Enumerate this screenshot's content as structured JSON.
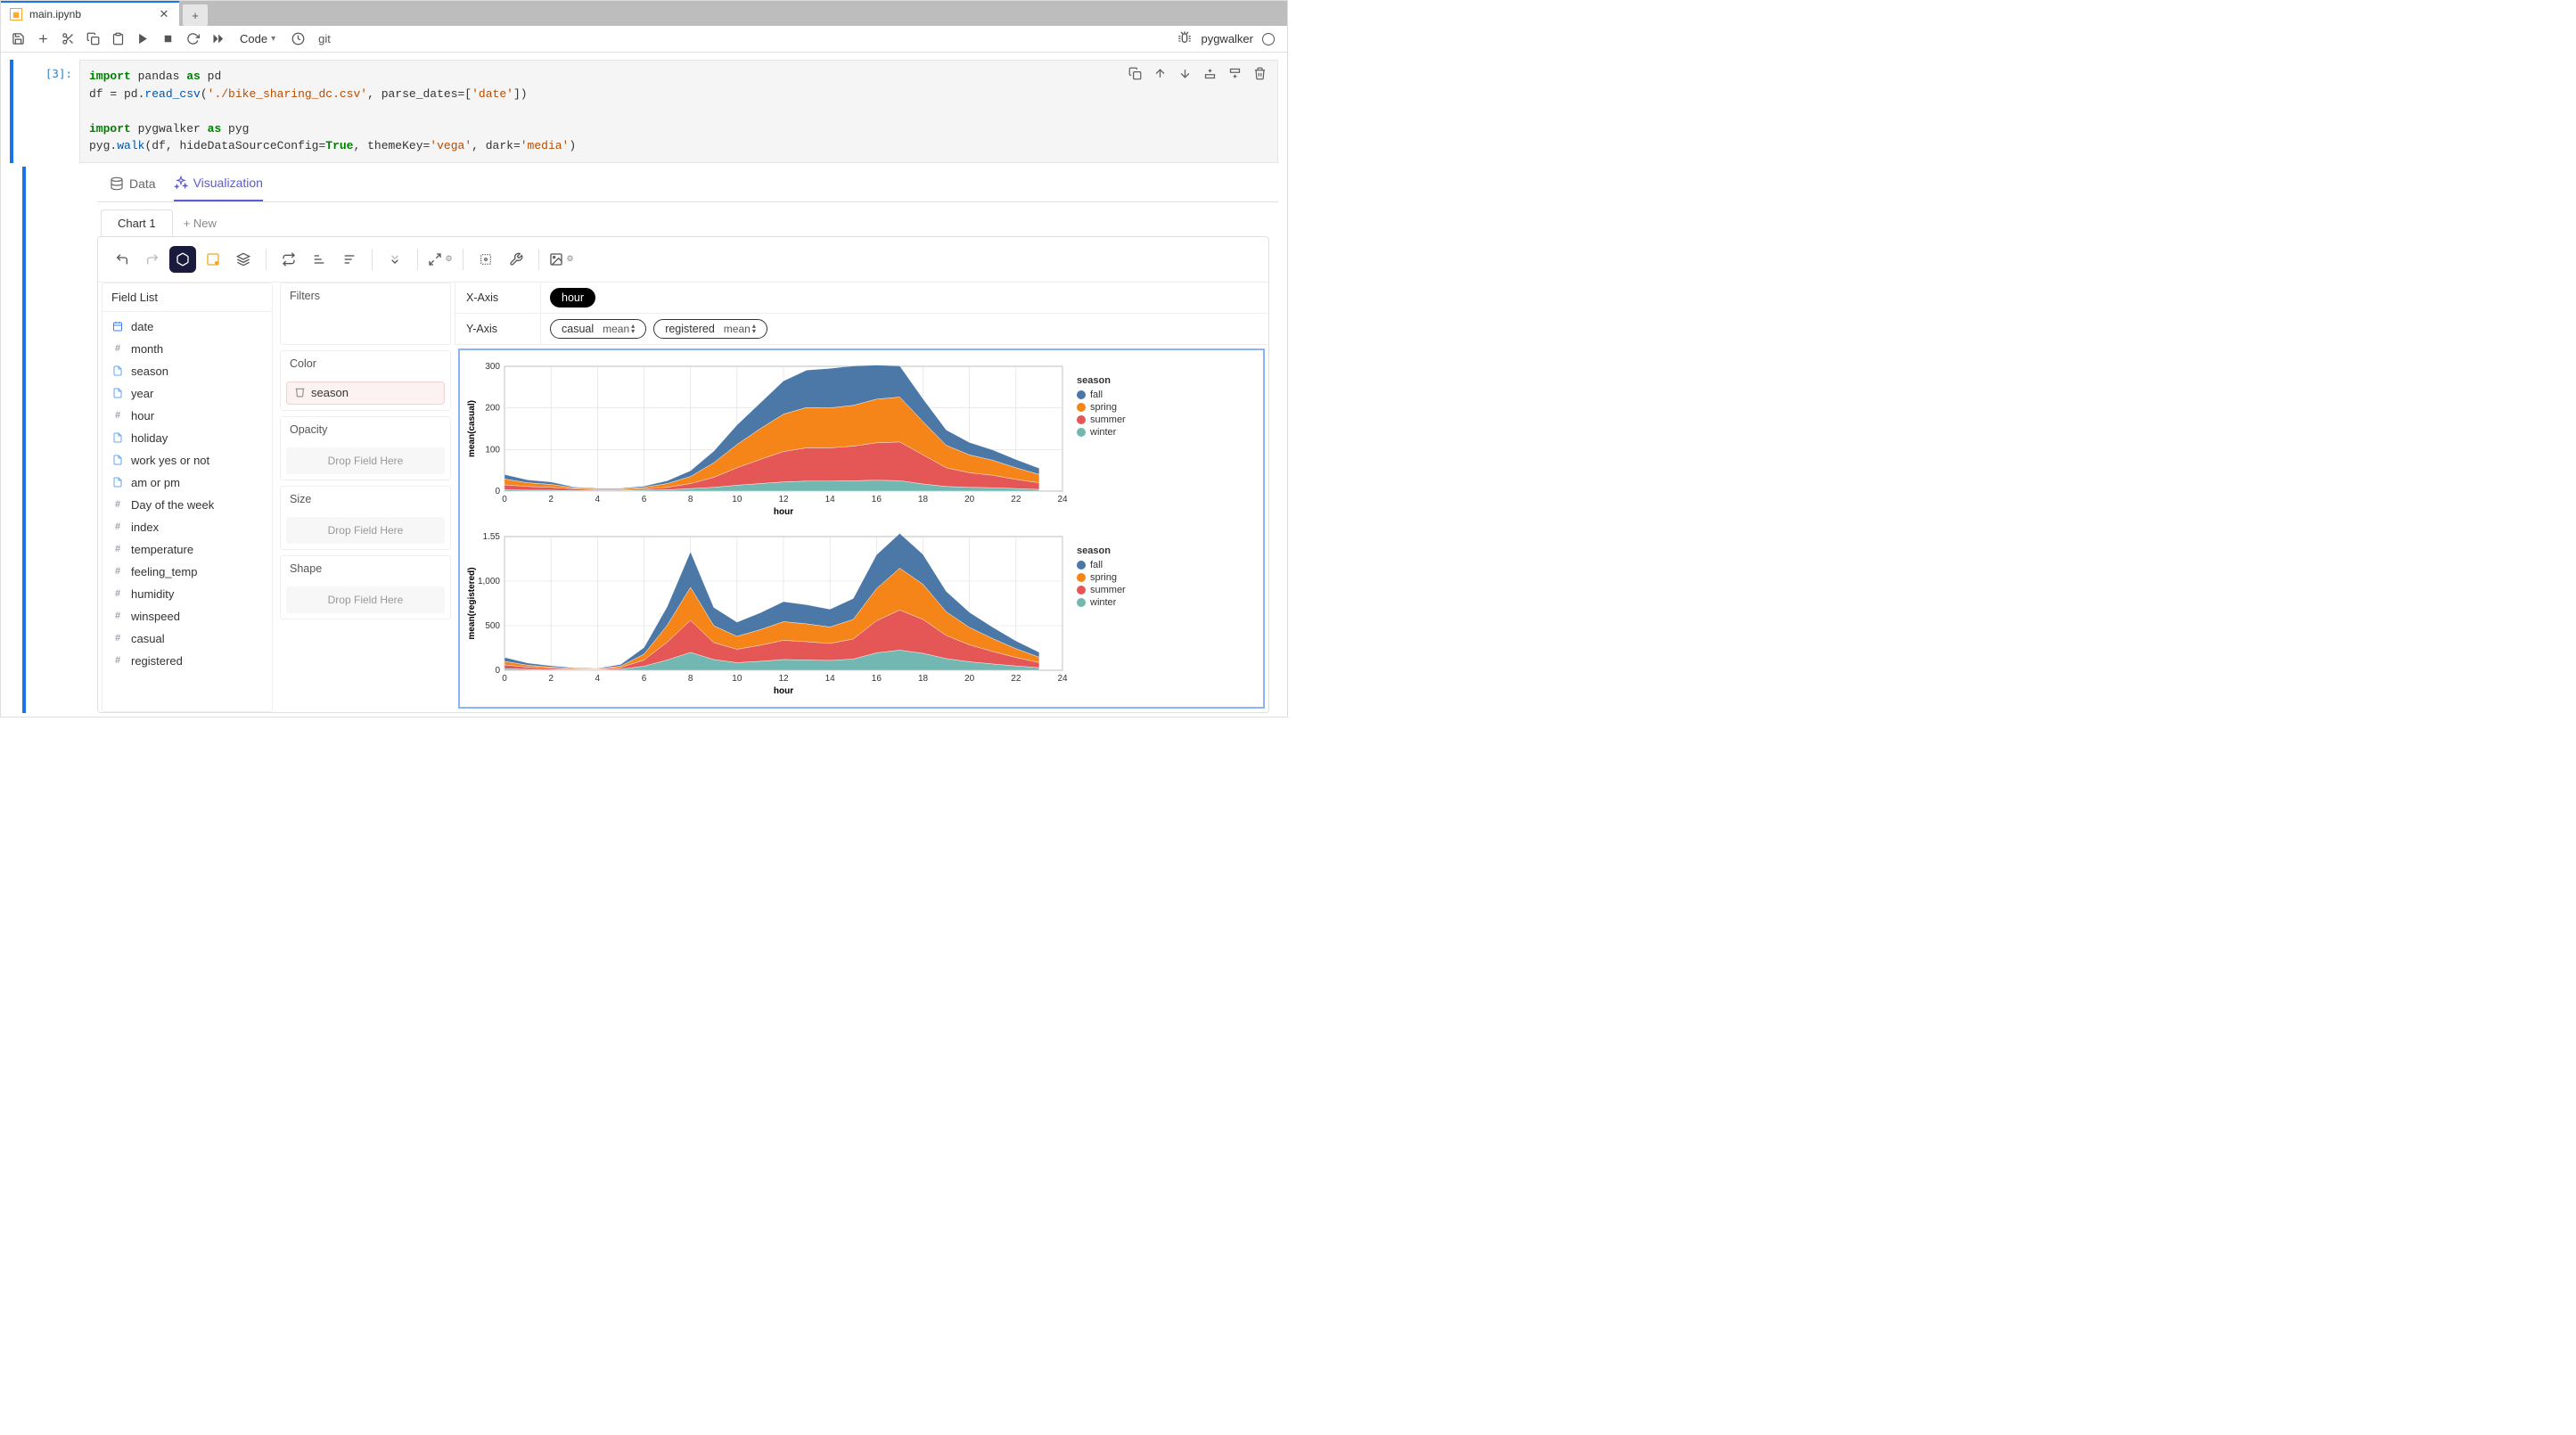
{
  "tab": {
    "title": "main.ipynb"
  },
  "toolbar": {
    "celltype": "Code",
    "git": "git",
    "kernel_name": "pygwalker"
  },
  "cell": {
    "prompt": "[3]:",
    "code_html": "<span class='kw'>import</span> pandas <span class='kw'>as</span> pd\ndf = pd.<span class='fn'>read_csv</span>(<span class='str'>'./bike_sharing_dc.csv'</span>, parse_dates=[<span class='str'>'date'</span>])\n\n<span class='kw'>import</span> pygwalker <span class='kw'>as</span> pyg\npyg.<span class='fn'>walk</span>(df, hideDataSourceConfig=<span class='cnst'>True</span>, themeKey=<span class='str'>'vega'</span>, dark=<span class='str'>'media'</span>)"
  },
  "pyg": {
    "tab_data": "Data",
    "tab_viz": "Visualization",
    "chart_tab": "Chart 1",
    "chart_tab_new": "+ New",
    "field_list_title": "Field List",
    "fields": [
      {
        "type": "cal",
        "name": "date"
      },
      {
        "type": "hash",
        "name": "month"
      },
      {
        "type": "txt",
        "name": "season"
      },
      {
        "type": "txt",
        "name": "year"
      },
      {
        "type": "hash",
        "name": "hour"
      },
      {
        "type": "txt",
        "name": "holiday"
      },
      {
        "type": "txt",
        "name": "work yes or not"
      },
      {
        "type": "txt",
        "name": "am or pm"
      },
      {
        "type": "hash",
        "name": "Day of the week"
      },
      {
        "type": "hash",
        "name": "index"
      },
      {
        "type": "hash",
        "name": "temperature"
      },
      {
        "type": "hash",
        "name": "feeling_temp"
      },
      {
        "type": "hash",
        "name": "humidity"
      },
      {
        "type": "hash",
        "name": "winspeed"
      },
      {
        "type": "hash",
        "name": "casual"
      },
      {
        "type": "hash",
        "name": "registered"
      }
    ],
    "shelves": {
      "filters": "Filters",
      "color": "Color",
      "color_value": "season",
      "opacity": "Opacity",
      "size": "Size",
      "shape": "Shape",
      "drop": "Drop Field Here"
    },
    "axes": {
      "x_label": "X-Axis",
      "y_label": "Y-Axis",
      "x_pill": "hour",
      "y_pill1": "casual",
      "y_pill1_agg": "mean",
      "y_pill2": "registered",
      "y_pill2_agg": "mean"
    },
    "legend": {
      "title": "season",
      "items": [
        {
          "name": "fall",
          "color": "#4c78a8"
        },
        {
          "name": "spring",
          "color": "#f58518"
        },
        {
          "name": "summer",
          "color": "#e45756"
        },
        {
          "name": "winter",
          "color": "#72b7b2"
        }
      ]
    }
  },
  "chart_data": [
    {
      "type": "area",
      "title": "",
      "xlabel": "hour",
      "ylabel": "mean(casual)",
      "x": [
        0,
        1,
        2,
        3,
        4,
        5,
        6,
        7,
        8,
        9,
        10,
        11,
        12,
        13,
        14,
        15,
        16,
        17,
        18,
        19,
        20,
        21,
        22,
        23
      ],
      "ylim": [
        0,
        300
      ],
      "grid": true,
      "stacked": true,
      "series": [
        {
          "name": "winter",
          "color": "#72b7b2",
          "values": [
            3,
            2,
            2,
            1,
            1,
            1,
            2,
            3,
            6,
            9,
            14,
            18,
            22,
            24,
            24,
            25,
            26,
            25,
            17,
            11,
            9,
            8,
            6,
            4
          ]
        },
        {
          "name": "summer",
          "color": "#e45756",
          "values": [
            12,
            9,
            7,
            4,
            2,
            2,
            3,
            6,
            12,
            24,
            42,
            58,
            73,
            80,
            80,
            83,
            90,
            93,
            70,
            45,
            35,
            30,
            22,
            16
          ]
        },
        {
          "name": "spring",
          "color": "#f58518",
          "values": [
            14,
            9,
            7,
            3,
            2,
            2,
            4,
            9,
            17,
            35,
            56,
            74,
            90,
            97,
            96,
            98,
            105,
            108,
            80,
            54,
            43,
            36,
            28,
            20
          ]
        },
        {
          "name": "fall",
          "color": "#4c78a8",
          "values": [
            11,
            7,
            6,
            2,
            2,
            2,
            3,
            7,
            14,
            28,
            47,
            62,
            80,
            90,
            95,
            95,
            82,
            75,
            55,
            37,
            30,
            25,
            20,
            15
          ]
        }
      ]
    },
    {
      "type": "area",
      "title": "",
      "xlabel": "hour",
      "ylabel": "mean(registered)",
      "x": [
        0,
        1,
        2,
        3,
        4,
        5,
        6,
        7,
        8,
        9,
        10,
        11,
        12,
        13,
        14,
        15,
        16,
        17,
        18,
        19,
        20,
        21,
        22,
        23
      ],
      "ylim": [
        0,
        1500
      ],
      "grid": true,
      "stacked": true,
      "series": [
        {
          "name": "winter",
          "color": "#72b7b2",
          "values": [
            18,
            10,
            6,
            4,
            4,
            12,
            45,
            115,
            200,
            120,
            85,
            100,
            120,
            115,
            110,
            125,
            195,
            225,
            190,
            130,
            95,
            70,
            48,
            28
          ]
        },
        {
          "name": "summer",
          "color": "#e45756",
          "values": [
            42,
            24,
            15,
            8,
            6,
            18,
            70,
            200,
            360,
            190,
            150,
            180,
            215,
            205,
            190,
            225,
            360,
            450,
            380,
            260,
            190,
            140,
            95,
            58
          ]
        },
        {
          "name": "spring",
          "color": "#f58518",
          "values": [
            40,
            22,
            14,
            8,
            6,
            16,
            65,
            190,
            370,
            190,
            145,
            175,
            210,
            200,
            185,
            220,
            360,
            470,
            395,
            265,
            195,
            145,
            98,
            60
          ]
        },
        {
          "name": "fall",
          "color": "#4c78a8",
          "values": [
            45,
            25,
            16,
            9,
            7,
            20,
            75,
            210,
            400,
            205,
            160,
            190,
            225,
            215,
            200,
            235,
            380,
            390,
            335,
            230,
            170,
            128,
            88,
            55
          ]
        }
      ]
    }
  ]
}
